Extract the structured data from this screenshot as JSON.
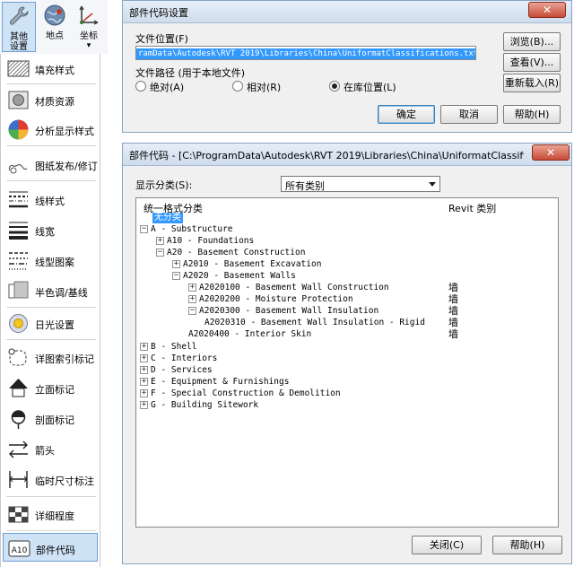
{
  "ribbon": {
    "buttons": [
      {
        "label_top": "其他",
        "label_bottom": "设置",
        "icon": "wrench-icon"
      },
      {
        "label_top": "地点",
        "label_bottom": "",
        "icon": "globe-icon"
      },
      {
        "label_top": "坐标",
        "label_bottom": "",
        "icon": "axes-icon"
      }
    ],
    "dropdown_glyph": "▾"
  },
  "menu": {
    "items": [
      {
        "label": "填充样式",
        "icon": "fill-pattern-icon"
      },
      {
        "label": "材质资源",
        "icon": "material-asset-icon"
      },
      {
        "label": "分析显示样式",
        "icon": "analysis-display-icon"
      },
      {
        "label": "图纸发布/修订",
        "icon": "sheet-revision-icon"
      },
      {
        "label": "线样式",
        "icon": "line-style-icon"
      },
      {
        "label": "线宽",
        "icon": "line-weight-icon"
      },
      {
        "label": "线型图案",
        "icon": "line-pattern-icon"
      },
      {
        "label": "半色调/基线",
        "icon": "halftone-icon"
      },
      {
        "label": "日光设置",
        "icon": "sun-settings-icon"
      },
      {
        "label": "详图索引标记",
        "icon": "callout-tag-icon"
      },
      {
        "label": "立面标记",
        "icon": "elevation-tag-icon"
      },
      {
        "label": "剖面标记",
        "icon": "section-tag-icon"
      },
      {
        "label": "箭头",
        "icon": "arrowhead-icon"
      },
      {
        "label": "临时尺寸标注",
        "icon": "temp-dimension-icon"
      },
      {
        "label": "详细程度",
        "icon": "detail-level-icon"
      },
      {
        "label": "部件代码",
        "icon": "assembly-code-icon"
      }
    ]
  },
  "settings_dialog": {
    "title": "部件代码设置",
    "close": "✕",
    "file_location_label": "文件位置(F)",
    "file_path_value": "ramData\\Autodesk\\RVT 2019\\Libraries\\China\\UniformatClassifications.txt",
    "browse_button": "浏览(B)...",
    "view_button": "查看(V)...",
    "reload_button": "重新载入(R)",
    "path_type_label": "文件路径 (用于本地文件)",
    "radio_absolute": "绝对(A)",
    "radio_relative": "相对(R)",
    "radio_library": "在库位置(L)",
    "ok_button": "确定",
    "cancel_button": "取消",
    "help_button": "帮助(H)"
  },
  "code_dialog": {
    "title": "部件代码 - [C:\\ProgramData\\Autodesk\\RVT 2019\\Libraries\\China\\UniformatClassificat...",
    "close": "✕",
    "show_label": "显示分类(S):",
    "show_value": "所有类别",
    "col_code": "统一格式分类",
    "col_category": "Revit 类别",
    "tree": [
      {
        "text": "无分类",
        "exp": "",
        "selected": true,
        "cat": ""
      },
      {
        "text": "A - Substructure",
        "exp": "−",
        "selected": false,
        "cat": ""
      },
      {
        "text": "A10 - Foundations",
        "exp": "+",
        "selected": false,
        "cat": ""
      },
      {
        "text": "A20 - Basement Construction",
        "exp": "−",
        "selected": false,
        "cat": ""
      },
      {
        "text": "A2010 - Basement Excavation",
        "exp": "+",
        "selected": false,
        "cat": ""
      },
      {
        "text": "A2020 - Basement Walls",
        "exp": "−",
        "selected": false,
        "cat": ""
      },
      {
        "text": "A2020100 - Basement Wall Construction",
        "exp": "+",
        "selected": false,
        "cat": "墙"
      },
      {
        "text": "A2020200 - Moisture Protection",
        "exp": "+",
        "selected": false,
        "cat": "墙"
      },
      {
        "text": "A2020300 - Basement Wall Insulation",
        "exp": "−",
        "selected": false,
        "cat": "墙"
      },
      {
        "text": "A2020310 - Basement Wall Insulation - Rigid",
        "exp": "",
        "selected": false,
        "cat": "墙"
      },
      {
        "text": "A2020400 - Interior Skin",
        "exp": "",
        "selected": false,
        "cat": "墙"
      },
      {
        "text": "B - Shell",
        "exp": "+",
        "selected": false,
        "cat": ""
      },
      {
        "text": "C - Interiors",
        "exp": "+",
        "selected": false,
        "cat": ""
      },
      {
        "text": "D - Services",
        "exp": "+",
        "selected": false,
        "cat": ""
      },
      {
        "text": "E - Equipment & Furnishings",
        "exp": "+",
        "selected": false,
        "cat": ""
      },
      {
        "text": "F - Special Construction & Demolition",
        "exp": "+",
        "selected": false,
        "cat": ""
      },
      {
        "text": "G - Building Sitework",
        "exp": "+",
        "selected": false,
        "cat": ""
      }
    ],
    "close_button": "关闭(C)",
    "help_button": "帮助(H)"
  }
}
